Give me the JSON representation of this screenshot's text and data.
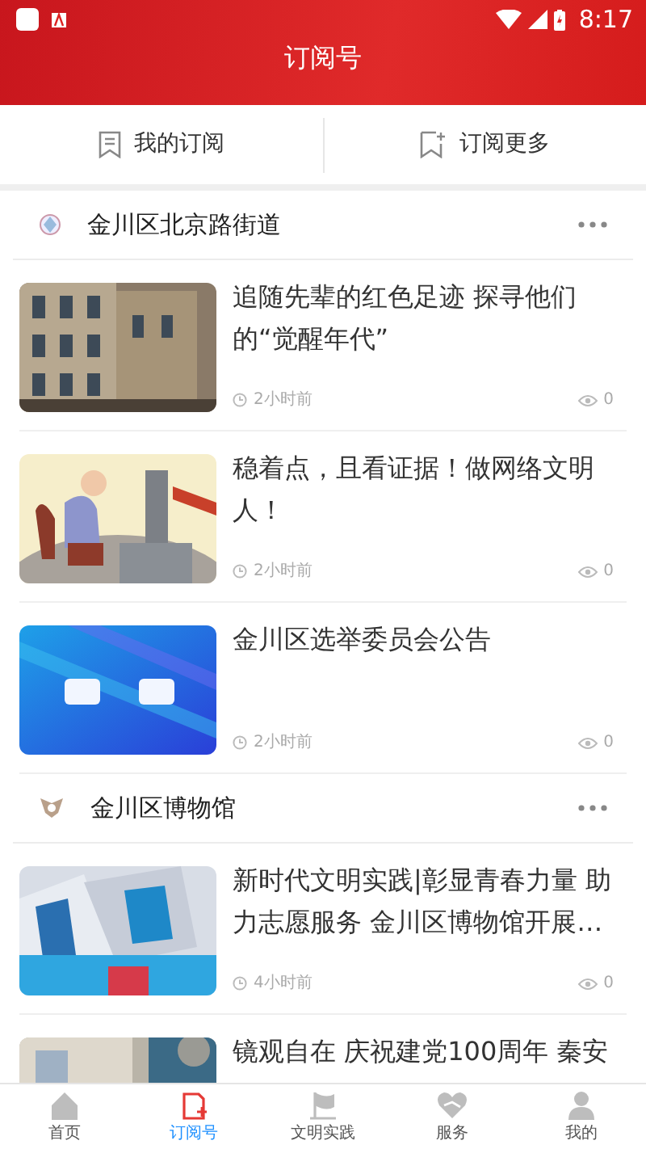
{
  "status_bar": {
    "time": "8:17"
  },
  "header": {
    "title": "订阅号"
  },
  "tabs": [
    {
      "label": "我的订阅",
      "kind": "mine"
    },
    {
      "label": "订阅更多",
      "kind": "more"
    }
  ],
  "channels": [
    {
      "name": "金川区北京路街道",
      "articles": [
        {
          "title": "追随先辈的红色足迹 探寻他们的“觉醒年代”",
          "time": "2小时前",
          "views": "0"
        },
        {
          "title": "稳着点，且看证据！做网络文明人！",
          "time": "2小时前",
          "views": "0"
        },
        {
          "title": "金川区选举委员会公告",
          "time": "2小时前",
          "views": "0"
        }
      ]
    },
    {
      "name": "金川区博物馆",
      "articles": [
        {
          "title": "新时代文明实践|彰显青春力量 助力志愿服务 金川区博物馆开展…",
          "time": "4小时前",
          "views": "0"
        },
        {
          "title": "镜观自在 庆祝建党100周年 秦安"
        }
      ]
    }
  ],
  "bottom_nav": [
    {
      "label": "首页",
      "kind": "home",
      "selected": false
    },
    {
      "label": "订阅号",
      "kind": "subscribe",
      "selected": true
    },
    {
      "label": "文明实践",
      "kind": "flag",
      "selected": false
    },
    {
      "label": "服务",
      "kind": "service",
      "selected": false
    },
    {
      "label": "我的",
      "kind": "person",
      "selected": false
    }
  ]
}
